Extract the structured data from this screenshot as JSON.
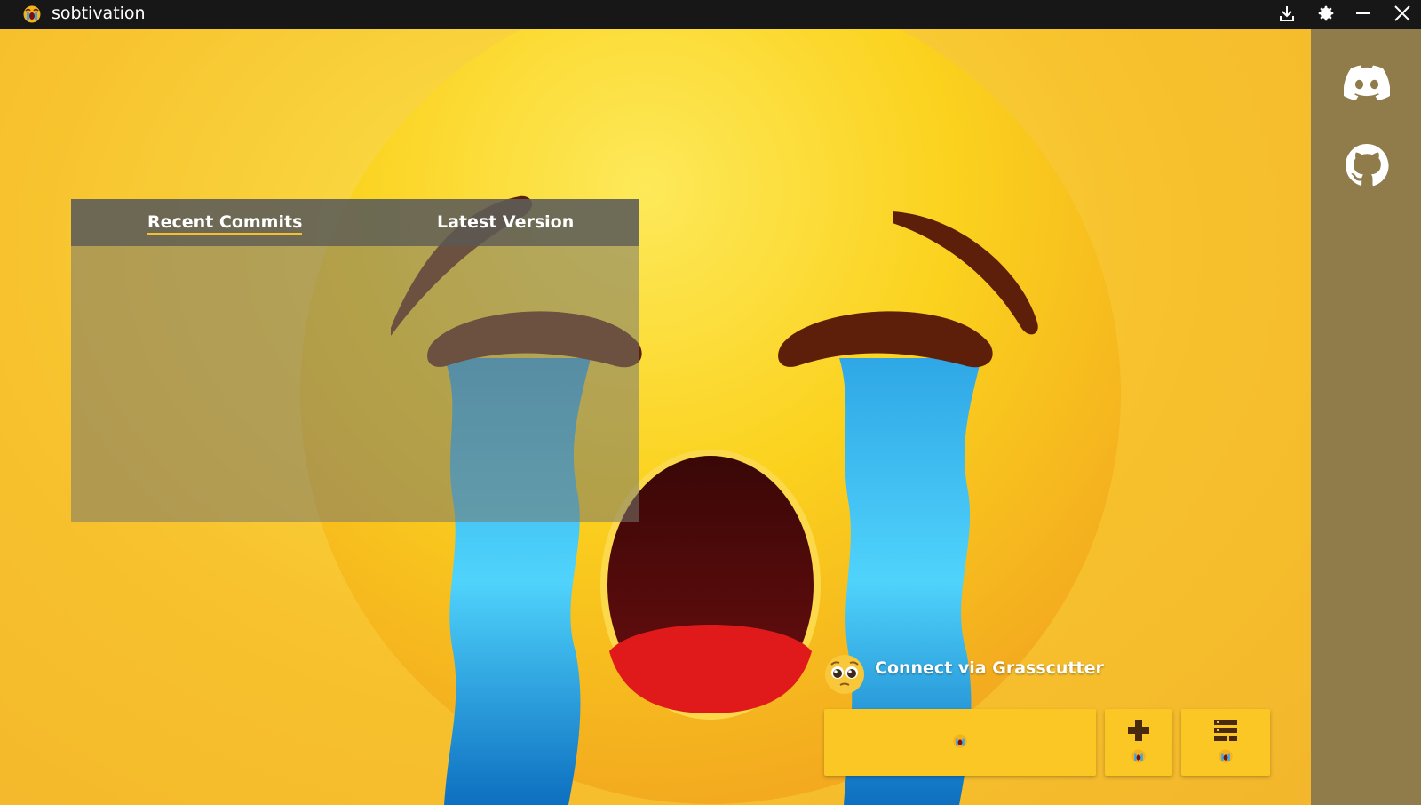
{
  "window": {
    "title": "sobtivation",
    "icons": {
      "app": "crying-face-icon",
      "download": "download-icon",
      "settings": "gear-icon",
      "minimize": "minimize-icon",
      "close": "close-icon"
    }
  },
  "sidebar": {
    "items": [
      {
        "icon": "discord-icon"
      },
      {
        "icon": "github-icon"
      }
    ]
  },
  "news": {
    "tabs": [
      {
        "label": "Recent Commits",
        "active": true
      },
      {
        "label": "Latest Version",
        "active": false
      }
    ]
  },
  "launch": {
    "connect_label": "Connect via Grasscutter",
    "connect_icon": "pleading-face-icon",
    "buttons": [
      {
        "name": "launch",
        "icon": "crying-face-icon"
      },
      {
        "name": "add",
        "icon": "plus-icon"
      },
      {
        "name": "server",
        "icon": "server-icon"
      }
    ]
  },
  "colors": {
    "titlebar": "#171717",
    "sidebar": "#8f7c4a",
    "button": "#fac724",
    "tab_underline": "#f5c030",
    "background": "#f5b82a"
  }
}
